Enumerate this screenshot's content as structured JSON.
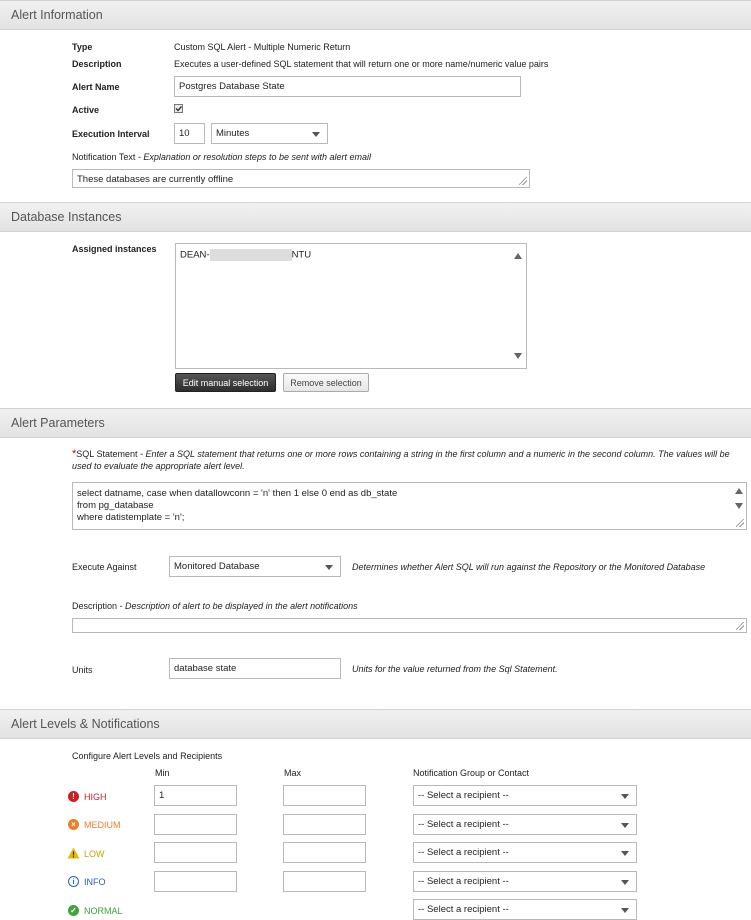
{
  "sections": {
    "alert_information": "Alert Information",
    "database_instances": "Database Instances",
    "alert_parameters": "Alert Parameters",
    "alert_levels": "Alert Levels & Notifications"
  },
  "alert_info": {
    "type_label": "Type",
    "type_value": "Custom SQL Alert - Multiple Numeric Return",
    "description_label": "Description",
    "description_value": "Executes a user-defined SQL statement that will return one or more name/numeric value pairs",
    "alert_name_label": "Alert Name",
    "alert_name_value": "Postgres Database State",
    "active_label": "Active",
    "active_checked": true,
    "interval_label": "Execution Interval",
    "interval_value": "10",
    "interval_unit": "Minutes",
    "notification_label": "Notification Text",
    "notification_hint": " - Explanation or resolution steps to be sent with alert email",
    "notification_value": "These databases are currently offline"
  },
  "db_instances": {
    "assigned_label": "Assigned instances",
    "instance_prefix": "DEAN-",
    "instance_suffix": "NTU",
    "edit_button": "Edit manual selection",
    "remove_button": "Remove selection"
  },
  "alert_params": {
    "required_mark": "*",
    "sql_label": "SQL Statement",
    "sql_hint": " - Enter a SQL statement that returns one or more rows containing a string in the first column and a numeric in the second column. The values will be used to evaluate the appropriate alert level.",
    "sql_lines": [
      "select datname, case when datallowconn = 'n' then 1 else 0 end as db_state",
      "from pg_database",
      "where datistemplate = 'n';"
    ],
    "execute_label": "Execute Against",
    "execute_value": "Monitored Database",
    "execute_hint": "Determines whether Alert SQL will run against the Repository or the Monitored Database",
    "description_label": "Description",
    "description_hint": " - Description of alert to be displayed in the alert notifications",
    "description_value": "",
    "units_label": "Units",
    "units_value": "database state",
    "units_hint": "Units for the value returned from the Sql Statement."
  },
  "levels": {
    "configure_label": "Configure Alert Levels and Recipients",
    "col_min": "Min",
    "col_max": "Max",
    "col_recipient": "Notification Group or Contact",
    "rows": [
      {
        "name": "HIGH",
        "color": "#cc1f1f",
        "icon": "!",
        "min": "1",
        "max": "",
        "recipient": "-- Select a recipient --"
      },
      {
        "name": "MEDIUM",
        "color": "#e8802a",
        "icon": "×",
        "min": "",
        "max": "",
        "recipient": "-- Select a recipient --"
      },
      {
        "name": "LOW",
        "color": "#d4a20a",
        "icon": "!",
        "min": "",
        "max": "",
        "recipient": "-- Select a recipient --"
      },
      {
        "name": "INFO",
        "color": "#2b5fb6",
        "icon": "i",
        "min": "",
        "max": "",
        "recipient": "-- Select a recipient --"
      },
      {
        "name": "NORMAL",
        "color": "#3fa33f",
        "icon": "✓",
        "min": "",
        "max": "",
        "recipient": "-- Select a recipient --"
      }
    ]
  }
}
